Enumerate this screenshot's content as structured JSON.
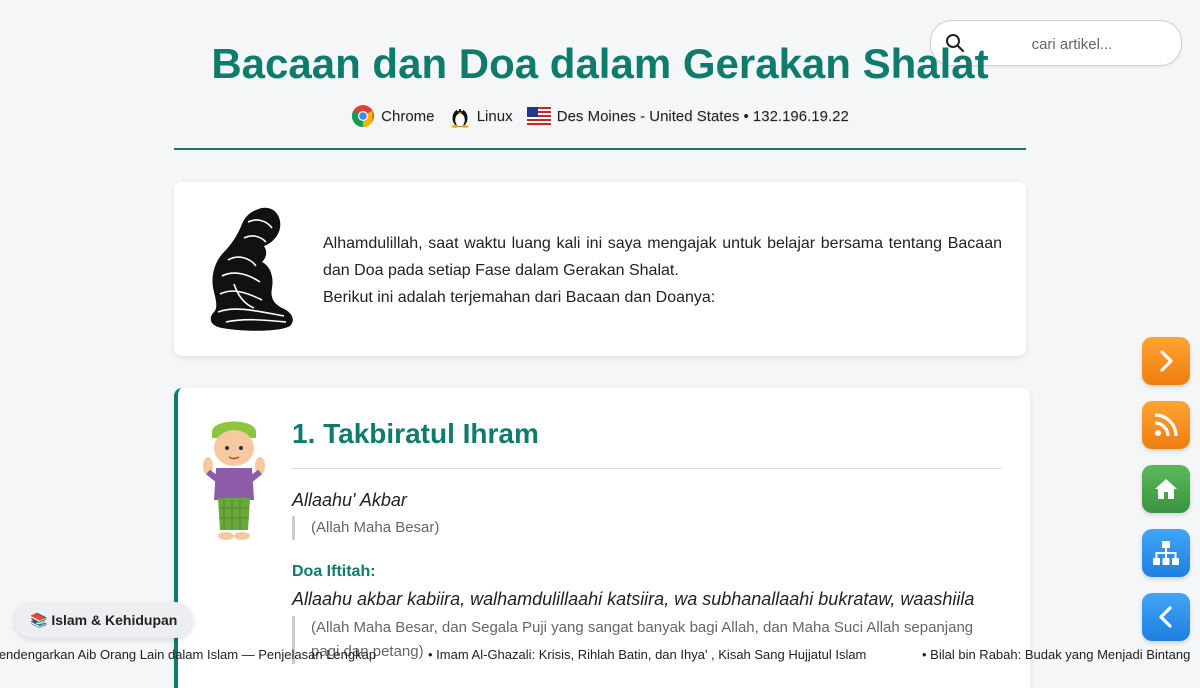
{
  "search": {
    "placeholder": "cari artikel..."
  },
  "page": {
    "title": "Bacaan dan Doa dalam Gerakan Shalat"
  },
  "visitor": {
    "browser": "Chrome",
    "os": "Linux",
    "location": "Des Moines - United States • 132.196.19.22"
  },
  "intro": {
    "line1": "Alhamdulillah, saat waktu luang kali ini saya mengajak untuk belajar bersama tentang Bacaan dan Doa pada setiap Fase dalam Gerakan Shalat.",
    "line2": "Berikut ini adalah terjemahan dari Bacaan dan Doanya:"
  },
  "section1": {
    "heading": "1. Takbiratul Ihram",
    "takbir": "Allaahu' Akbar",
    "takbir_translation": "(Allah Maha Besar)",
    "doa_label": "Doa Iftitah:",
    "doa_text": "Allaahu akbar kabiira, walhamdulillaahi katsiira, wa subhanallaahi bukrataw, waashiila",
    "doa_translation": "(Allah Maha Besar, dan Segala Puji yang sangat banyak bagi Allah, dan Maha Suci Allah sepanjang pagi dan petang)"
  },
  "category_badge": {
    "label": "📚 Islam & Kehidupan"
  },
  "ticker": {
    "item1": "Mendengarkan Aib Orang Lain dalam Islam — Penjelasan Lengkap",
    "item2": "• Imam Al-Ghazali: Krisis, Rihlah Batin, dan Ihya' , Kisah Sang Hujjatul Islam",
    "item3": "• Bilal bin Rabah: Budak yang Menjadi Bintang"
  },
  "side_buttons": [
    "chevron-right-icon",
    "rss-icon",
    "home-icon",
    "sitemap-icon",
    "chevron-left-icon"
  ],
  "colors": {
    "accent": "#0f7b6c",
    "orange": "#f07d10",
    "green": "#3a9440",
    "blue": "#1e80e0"
  }
}
